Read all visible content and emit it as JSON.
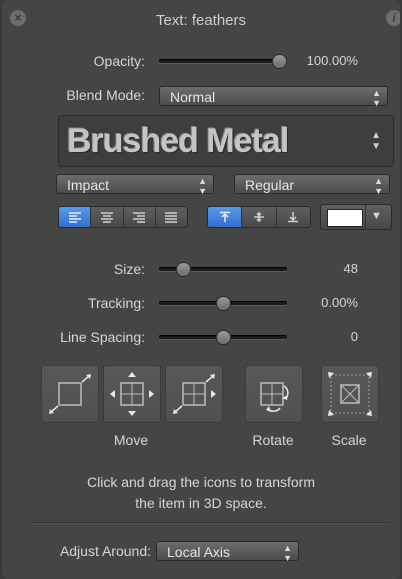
{
  "window": {
    "title": "Text: feathers"
  },
  "opacity": {
    "label": "Opacity:",
    "value": "100.00%",
    "level": 1.0
  },
  "blend_mode": {
    "label": "Blend Mode:",
    "selected": "Normal"
  },
  "preset": {
    "name": "Brushed Metal"
  },
  "font": {
    "family": "Impact",
    "style": "Regular"
  },
  "alignment": {
    "horizontal_selected": "left",
    "vertical_selected": "top"
  },
  "color": {
    "swatch": "#ffffff",
    "accent": "#3a7fdc"
  },
  "size": {
    "label": "Size:",
    "value": "48",
    "level": 0.15
  },
  "tracking": {
    "label": "Tracking:",
    "value": "0.00%",
    "level": 0.5
  },
  "line_spacing": {
    "label": "Line Spacing:",
    "value": "0",
    "level": 0.5
  },
  "transform": {
    "move_label": "Move",
    "rotate_label": "Rotate",
    "scale_label": "Scale",
    "help_line1": "Click and drag the icons to transform",
    "help_line2": "the item in 3D space."
  },
  "adjust_around": {
    "label": "Adjust Around:",
    "selected": "Local Axis"
  }
}
